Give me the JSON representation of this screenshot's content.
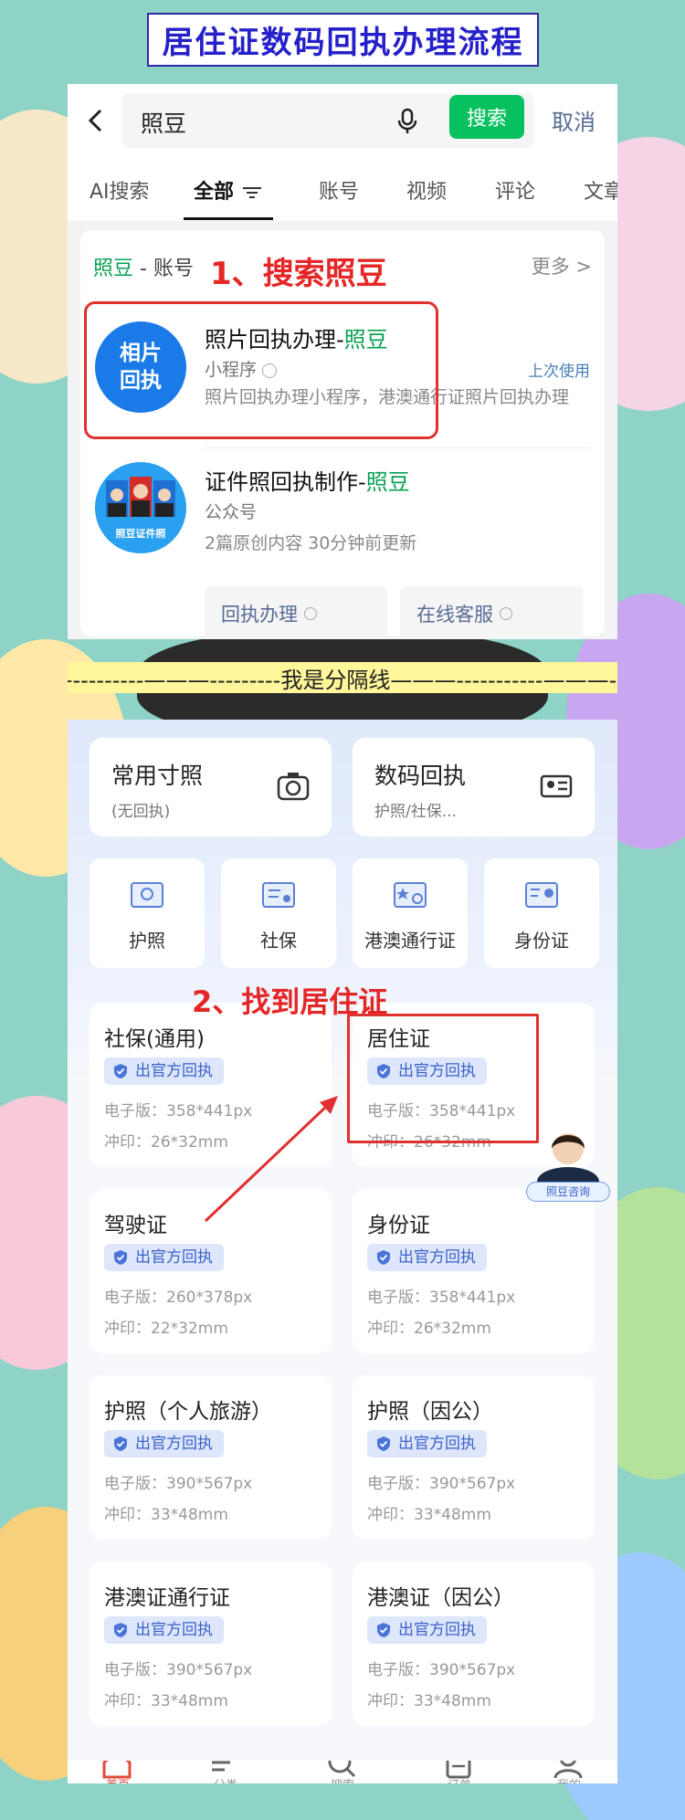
{
  "header": {
    "title": "居住证数码回执办理流程"
  },
  "search": {
    "query": "照豆",
    "button": "搜索",
    "cancel": "取消",
    "tabs": [
      "AI搜索",
      "全部",
      "账号",
      "视频",
      "评论",
      "文章"
    ],
    "section_brand": "照豆",
    "section_suffix": " - 账号",
    "more": "更多 >",
    "results": [
      {
        "title_prefix": "照片回执办理-",
        "title_brand": "照豆",
        "type": "小程序",
        "desc": "照片回执办理小程序，港澳通行证照片回执办理",
        "last_used": "上次使用",
        "avatar_text": [
          "相片",
          "回执"
        ]
      },
      {
        "title_prefix": "证件照回执制作-",
        "title_brand": "照豆",
        "type": "公众号",
        "desc": "2篇原创内容  30分钟前更新",
        "avatar_text": "照豆证件照",
        "services": [
          "回执办理",
          "在线客服"
        ]
      }
    ]
  },
  "annotations": {
    "step1": "1、搜索照豆",
    "step2": "2、找到居住证"
  },
  "separator": "——---------———---------我是分隔线———-----------———------",
  "app": {
    "big_cards": [
      {
        "title": "常用寸照",
        "sub": "(无回执)"
      },
      {
        "title": "数码回执",
        "sub": "护照/社保..."
      }
    ],
    "small_cards": [
      "护照",
      "社保",
      "港澳通行证",
      "身份证"
    ],
    "badge": "出官方回执",
    "docs": [
      {
        "name": "社保(通用)",
        "digital": "电子版：358*441px",
        "print": "冲印：26*32mm"
      },
      {
        "name": "居住证",
        "digital": "电子版：358*441px",
        "print": "冲印：26*32mm"
      },
      {
        "name": "驾驶证",
        "digital": "电子版：260*378px",
        "print": "冲印：22*32mm"
      },
      {
        "name": "身份证",
        "digital": "电子版：358*441px",
        "print": "冲印：26*32mm"
      },
      {
        "name": "护照（个人旅游）",
        "digital": "电子版：390*567px",
        "print": "冲印：33*48mm"
      },
      {
        "name": "护照（因公）",
        "digital": "电子版：390*567px",
        "print": "冲印：33*48mm"
      },
      {
        "name": "港澳证通行证",
        "digital": "电子版：390*567px",
        "print": "冲印：33*48mm"
      },
      {
        "name": "港澳证（因公）",
        "digital": "电子版：390*567px",
        "print": "冲印：33*48mm"
      }
    ],
    "consult": "照豆咨询",
    "tabbar": [
      "首页",
      "分类",
      "搜索",
      "订单",
      "我的"
    ]
  },
  "colors": {
    "accent_green": "#07c160",
    "annotation_red": "#e52626",
    "title_blue": "#2520c9"
  }
}
